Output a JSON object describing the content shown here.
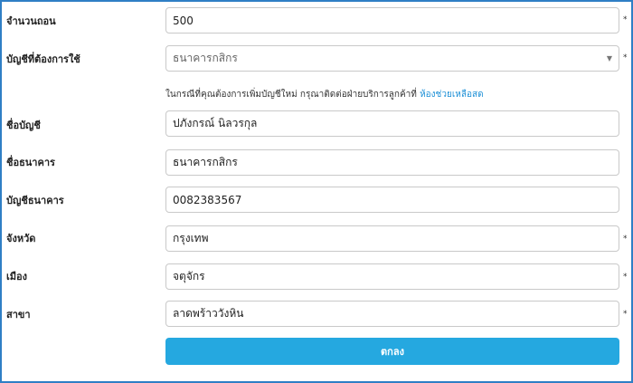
{
  "form": {
    "withdraw_amount": {
      "label": "จำนวนถอน",
      "value": "500",
      "required": "*"
    },
    "account_select": {
      "label": "บัญชีที่ต้องการใช้",
      "value": "ธนาคารกสิกร",
      "required": "*"
    },
    "help": {
      "text": "ในกรณีที่คุณต้องการเพิ่มบัญชีใหม่ กรุณาติดต่อฝ่ายบริการลูกค้าที่ ",
      "link": "ห้องช่วยเหลือสด"
    },
    "account_name": {
      "label": "ชื่อบัญชี",
      "value": "ปภังกรณ์ นิลวรกุล"
    },
    "bank_name": {
      "label": "ชื่อธนาคาร",
      "value": "ธนาคารกสิกร"
    },
    "account_number": {
      "label": "บัญชีธนาคาร",
      "value": "0082383567"
    },
    "province": {
      "label": "จังหวัด",
      "value": "กรุงเทพ",
      "required": "*"
    },
    "district": {
      "label": "เมือง",
      "value": "จตุจักร",
      "required": "*"
    },
    "branch": {
      "label": "สาขา",
      "value": "ลาดพร้าววังหิน",
      "required": "*"
    },
    "submit_label": "ตกลง"
  },
  "colors": {
    "border": "#2f7fc5",
    "button": "#25a8e0",
    "link": "#1c8fd6"
  }
}
